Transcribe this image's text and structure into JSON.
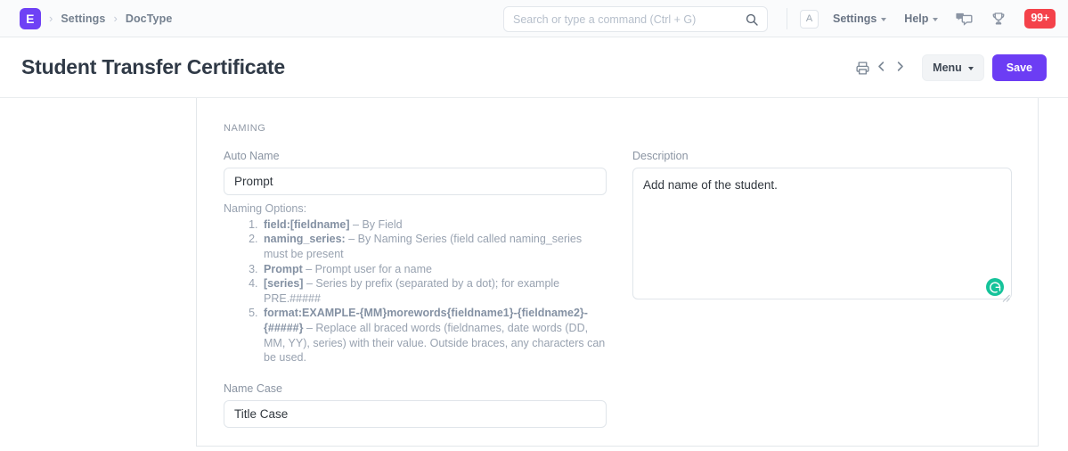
{
  "navbar": {
    "logo_letter": "E",
    "breadcrumbs": [
      {
        "label": "Settings"
      },
      {
        "label": "DocType"
      }
    ],
    "separator": "›",
    "search": {
      "placeholder": "Search or type a command (Ctrl + G)",
      "value": "",
      "icon": "search-icon"
    },
    "avatar_letter": "A",
    "menus": [
      {
        "label": "Settings"
      },
      {
        "label": "Help"
      }
    ],
    "icons": [
      {
        "name": "chat-icon"
      },
      {
        "name": "trophy-icon"
      }
    ],
    "notification_badge": "99+",
    "badge_color": "#f4424a",
    "brand_color": "#6e41f5"
  },
  "pagehead": {
    "title": "Student Transfer Certificate",
    "print_icon": "print-icon",
    "prev_icon": "chevron-left-icon",
    "next_icon": "chevron-right-icon",
    "menu_label": "Menu",
    "save_label": "Save",
    "save_color": "#6c3df4"
  },
  "form": {
    "section_label": "NAMING",
    "auto_name": {
      "label": "Auto Name",
      "value": "Prompt",
      "placeholder": ""
    },
    "naming_options": {
      "heading": "Naming Options:",
      "items": [
        {
          "term": "field:[fieldname]",
          "desc": " – By Field"
        },
        {
          "term": "naming_series:",
          "desc": " – By Naming Series (field called naming_series must be present"
        },
        {
          "term": "Prompt",
          "desc": " – Prompt user for a name"
        },
        {
          "term": "[series]",
          "desc": " – Series by prefix (separated by a dot); for example PRE.#####"
        },
        {
          "term": "format:EXAMPLE-{MM}morewords{fieldname1}-{fieldname2}-{#####}",
          "desc": " – Replace all braced words (fieldnames, date words (DD, MM, YY), series) with their value. Outside braces, any characters can be used."
        }
      ]
    },
    "name_case": {
      "label": "Name Case",
      "value": "Title Case",
      "placeholder": ""
    },
    "description": {
      "label": "Description",
      "value": "Add name of the student.",
      "placeholder": "",
      "assistant_icon": "grammarly-icon",
      "assistant_color": "#15c39a"
    }
  }
}
